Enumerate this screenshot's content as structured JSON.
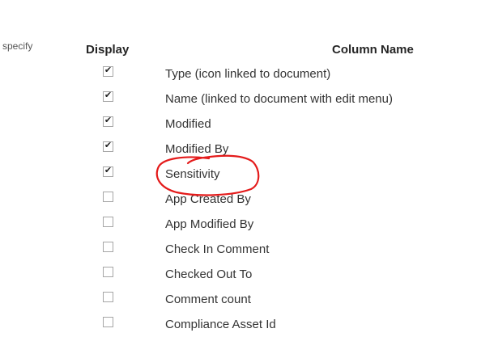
{
  "side_text": "specify",
  "headers": {
    "display": "Display",
    "column_name": "Column Name"
  },
  "rows": [
    {
      "label": "Type (icon linked to document)",
      "checked": true
    },
    {
      "label": "Name (linked to document with edit menu)",
      "checked": true
    },
    {
      "label": "Modified",
      "checked": true
    },
    {
      "label": "Modified By",
      "checked": true
    },
    {
      "label": "Sensitivity",
      "checked": true
    },
    {
      "label": "App Created By",
      "checked": false
    },
    {
      "label": "App Modified By",
      "checked": false
    },
    {
      "label": "Check In Comment",
      "checked": false
    },
    {
      "label": "Checked Out To",
      "checked": false
    },
    {
      "label": "Comment count",
      "checked": false
    },
    {
      "label": "Compliance Asset Id",
      "checked": false
    }
  ],
  "colors": {
    "annotation": "#e41b1b"
  }
}
